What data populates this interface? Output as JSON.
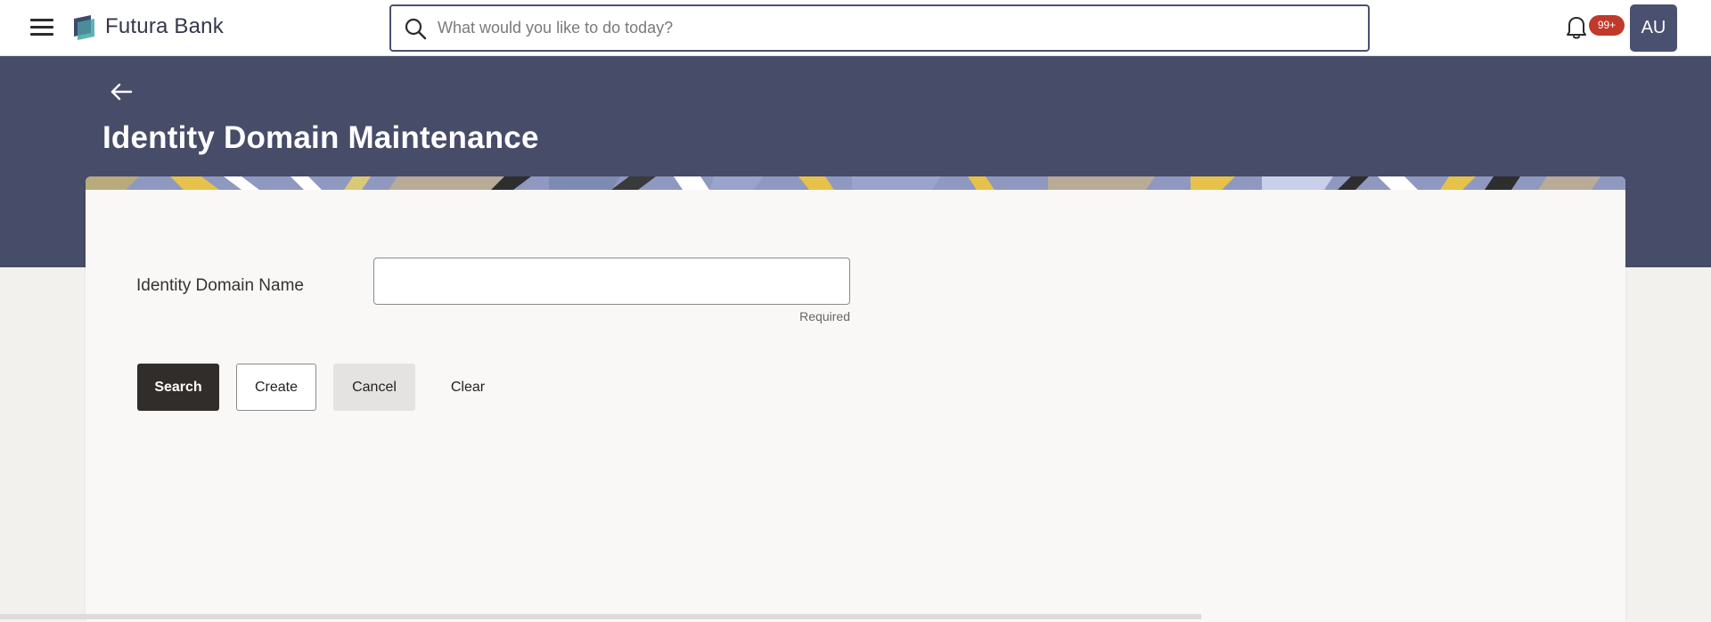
{
  "app": {
    "brand_name": "Futura Bank"
  },
  "search": {
    "placeholder": "What would you like to do today?",
    "value": ""
  },
  "notifications": {
    "badge": "99+"
  },
  "user": {
    "initials": "AU"
  },
  "page": {
    "title": "Identity Domain Maintenance"
  },
  "form": {
    "identity_domain_name": {
      "label": "Identity Domain Name",
      "value": "",
      "hint": "Required"
    }
  },
  "buttons": {
    "search": "Search",
    "create": "Create",
    "cancel": "Cancel",
    "clear": "Clear"
  },
  "colors": {
    "header_band": "#474c69",
    "primary_button": "#312d2a",
    "badge": "#c0392b",
    "avatar": "#4a5070"
  },
  "icons": {
    "menu": "hamburger-menu-icon",
    "logo": "bank-logo-icon",
    "search": "search-icon",
    "notifications": "bell-icon",
    "back": "back-arrow-icon"
  }
}
